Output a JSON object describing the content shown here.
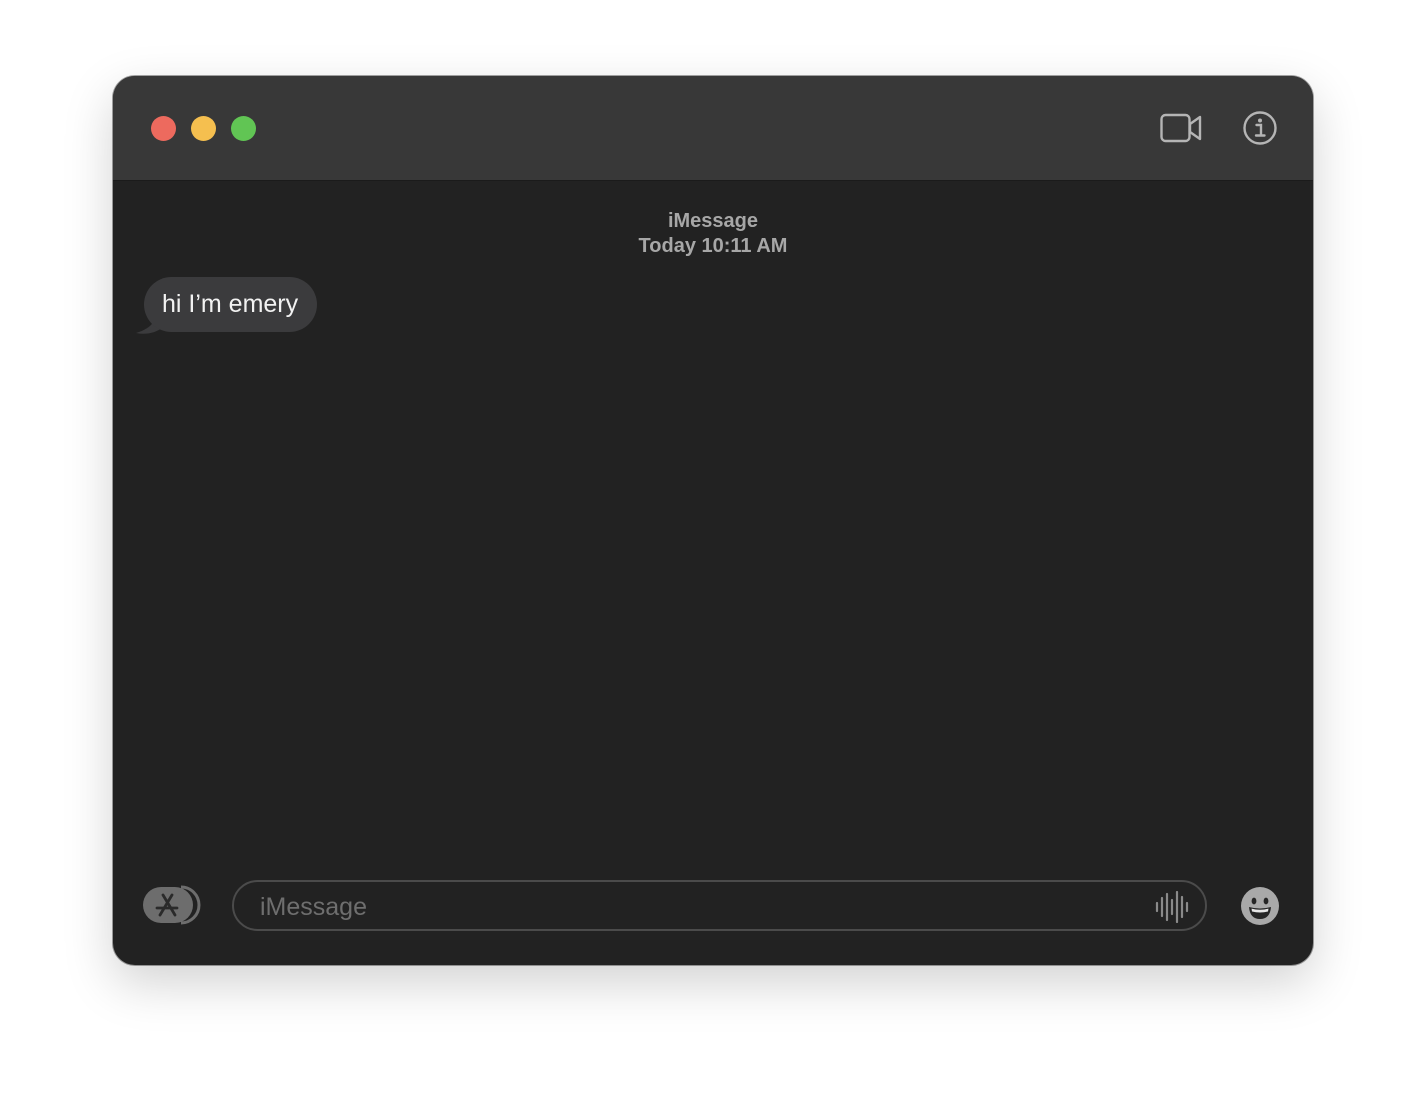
{
  "window": {
    "controls": [
      "close",
      "minimize",
      "zoom"
    ],
    "toolbar": {
      "video_icon": "video-camera-icon",
      "info_icon": "info-icon"
    }
  },
  "conversation": {
    "service": "iMessage",
    "timestamp": "Today 10:11 AM",
    "messages": [
      {
        "direction": "incoming",
        "text": "hi I’m emery"
      }
    ]
  },
  "composer": {
    "placeholder": "iMessage",
    "value": "",
    "apps_icon": "app-store-icon",
    "audio_icon": "audio-waveform-icon",
    "emoji_icon": "emoji-icon"
  },
  "colors": {
    "background": "#222222",
    "titlebar": "#383838",
    "bubble_incoming": "#3b3b3d",
    "close": "#ed6a5e",
    "minimize": "#f5bf4f",
    "zoom": "#61c554"
  }
}
